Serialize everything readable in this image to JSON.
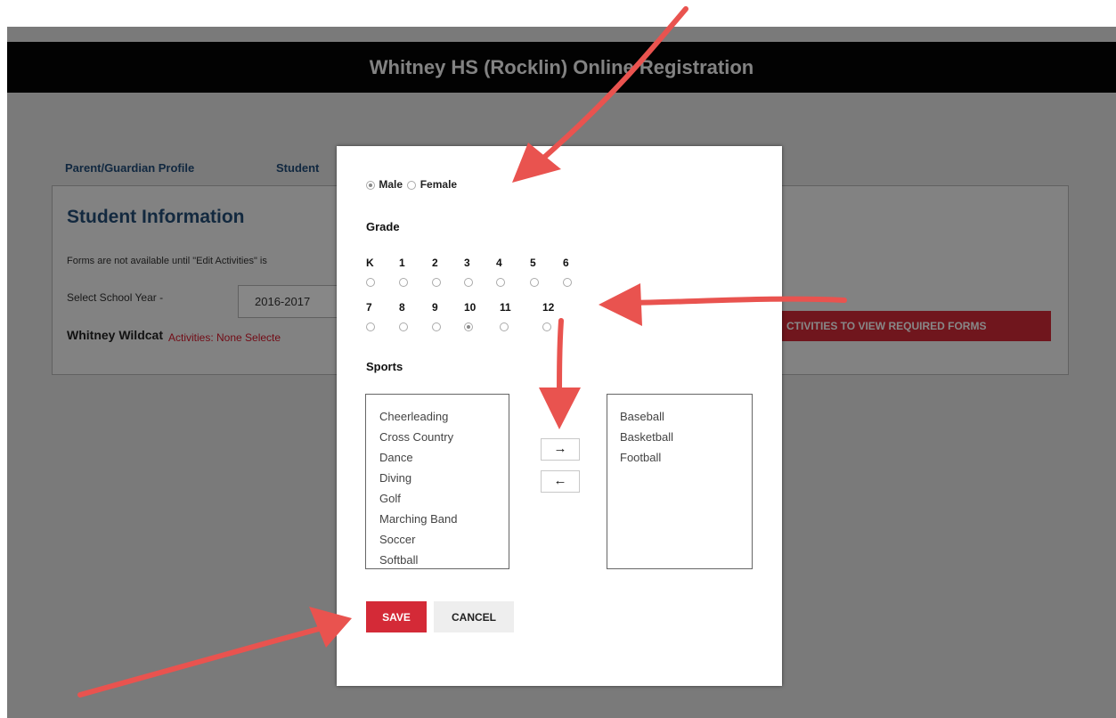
{
  "app": {
    "title": "Whitney HS (Rocklin) Online Registration"
  },
  "navigation": [
    {
      "label": "Parent/Guardian Profile"
    },
    {
      "label": "Student"
    }
  ],
  "student_panel": {
    "title": "Student Information",
    "forms_note": "Forms are not available until \"Edit Activities\" is",
    "school_year_label": "Select School Year -",
    "school_year": "2016-2017",
    "student_name": "Whitney Wildcat",
    "activities_text": "Activities: None Selecte",
    "required_forms_button": "CTIVITIES TO VIEW REQUIRED FORMS"
  },
  "dialog": {
    "gender_options": [
      "Male",
      "Female"
    ],
    "selected_gender": "Male",
    "grade_label": "Grade",
    "grades": [
      "K",
      "1",
      "2",
      "3",
      "4",
      "5",
      "6",
      "7",
      "8",
      "9",
      "10",
      "11",
      "12"
    ],
    "selected_grade": "10",
    "sports_label": "Sports",
    "available_sports": [
      "Cheerleading",
      "Cross Country",
      "Dance",
      "Diving",
      "Golf",
      "Marching Band",
      "Soccer",
      "Softball"
    ],
    "selected_sports": [
      "Baseball",
      "Basketball",
      "Football"
    ],
    "move_right_label": "→",
    "move_left_label": "←",
    "save_label": "SAVE",
    "cancel_label": "CANCEL"
  },
  "colors": {
    "header_background": "#050505",
    "link_blue": "#214d7a",
    "save_red": "#d42a37",
    "annotation_red": "#e9534f"
  }
}
